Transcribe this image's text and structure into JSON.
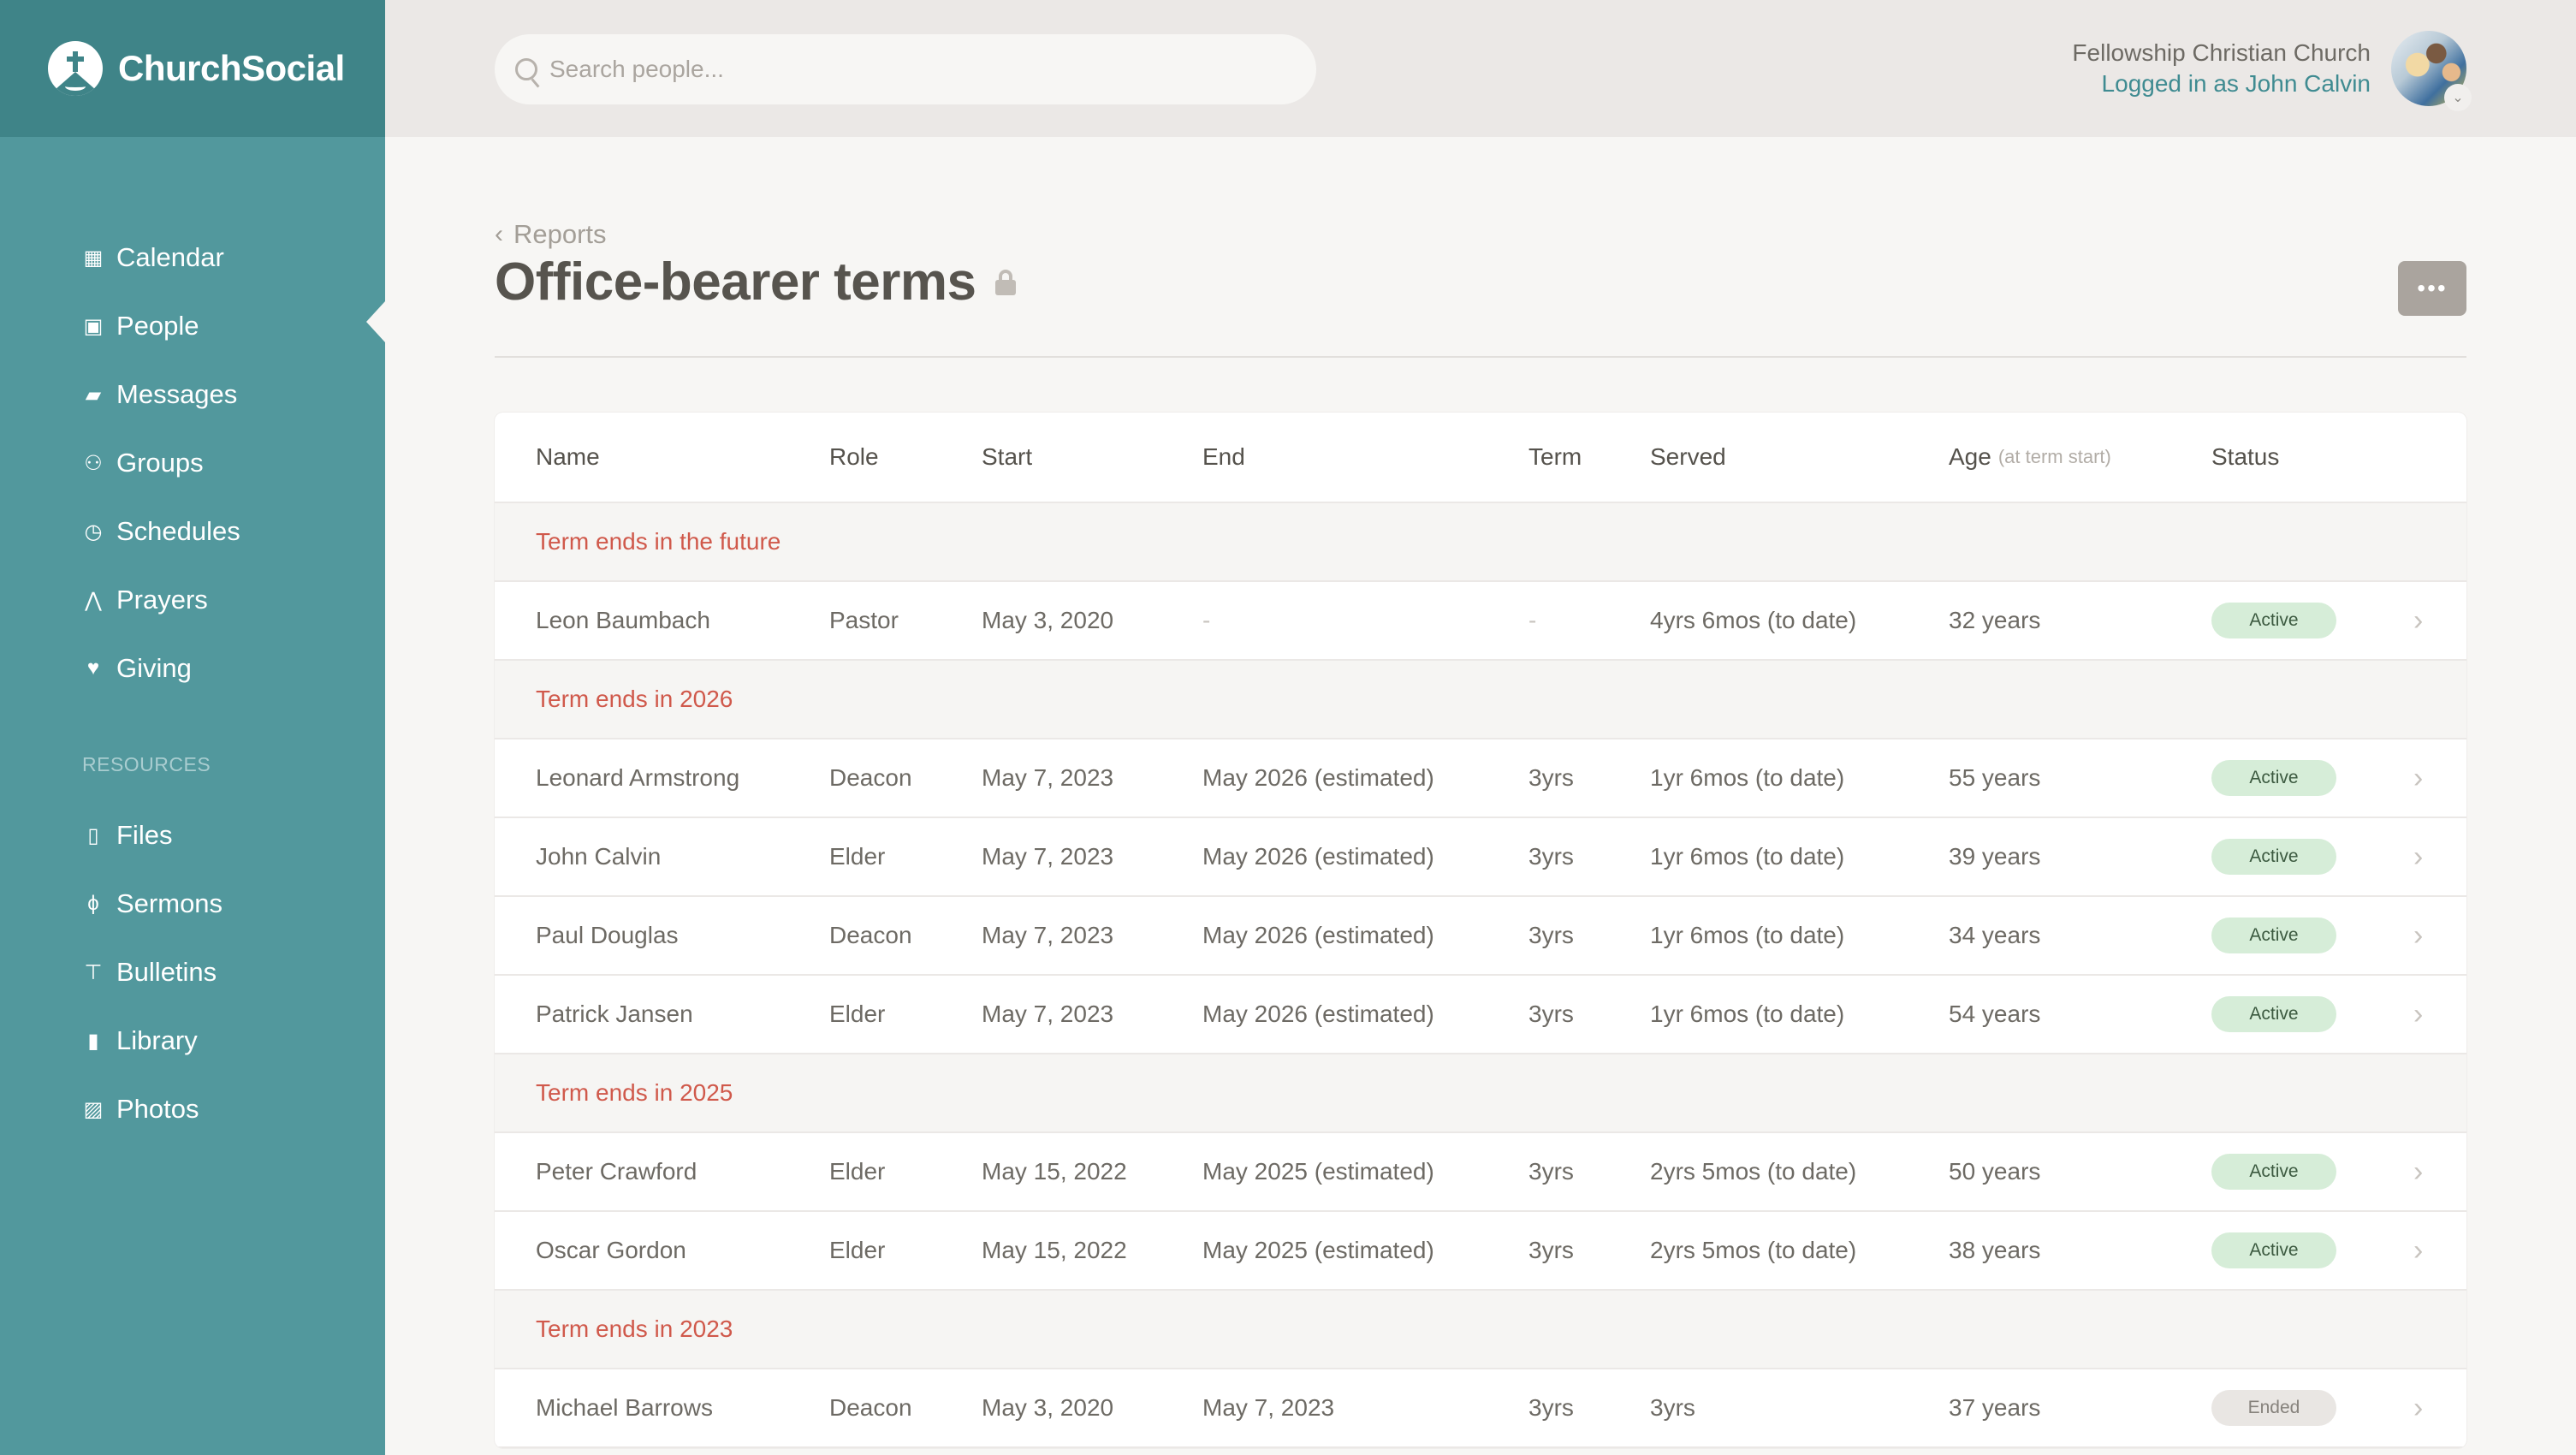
{
  "brand": {
    "name": "ChurchSocial",
    "logo_icon": "church-cross-icon"
  },
  "sidebar": {
    "items": [
      {
        "label": "Calendar",
        "icon": "calendar-icon",
        "glyph": "▦"
      },
      {
        "label": "People",
        "icon": "people-card-icon",
        "glyph": "▣",
        "active": true
      },
      {
        "label": "Messages",
        "icon": "chat-bubbles-icon",
        "glyph": "▰"
      },
      {
        "label": "Groups",
        "icon": "group-icon",
        "glyph": "⚇"
      },
      {
        "label": "Schedules",
        "icon": "clock-icon",
        "glyph": "◷"
      },
      {
        "label": "Prayers",
        "icon": "praying-hands-icon",
        "glyph": "⋀"
      },
      {
        "label": "Giving",
        "icon": "heart-icon",
        "glyph": "♥"
      }
    ],
    "section_label": "RESOURCES",
    "resources": [
      {
        "label": "Files",
        "icon": "file-icon",
        "glyph": "▯"
      },
      {
        "label": "Sermons",
        "icon": "microphone-icon",
        "glyph": "ϕ"
      },
      {
        "label": "Bulletins",
        "icon": "pushpin-icon",
        "glyph": "⊤"
      },
      {
        "label": "Library",
        "icon": "book-icon",
        "glyph": "▮"
      },
      {
        "label": "Photos",
        "icon": "image-icon",
        "glyph": "▨"
      }
    ]
  },
  "header": {
    "search_placeholder": "Search people...",
    "search_value": "",
    "church_name": "Fellowship Christian Church",
    "logged_in_text": "Logged in as John Calvin"
  },
  "page": {
    "breadcrumb": "Reports",
    "title": "Office-bearer terms",
    "more_label": "•••"
  },
  "table": {
    "columns": {
      "name": "Name",
      "role": "Role",
      "start": "Start",
      "end": "End",
      "term": "Term",
      "served": "Served",
      "age": "Age",
      "age_sub": "(at term start)",
      "status": "Status"
    },
    "groups": [
      {
        "label": "Term ends in the future",
        "rows": [
          {
            "name": "Leon Baumbach",
            "role": "Pastor",
            "start": "May 3, 2020",
            "end": "-",
            "term": "-",
            "served": "4yrs 6mos (to date)",
            "age": "32 years",
            "status": "Active"
          }
        ]
      },
      {
        "label": "Term ends in 2026",
        "rows": [
          {
            "name": "Leonard Armstrong",
            "role": "Deacon",
            "start": "May 7, 2023",
            "end": "May 2026 (estimated)",
            "term": "3yrs",
            "served": "1yr 6mos (to date)",
            "age": "55 years",
            "status": "Active"
          },
          {
            "name": "John Calvin",
            "role": "Elder",
            "start": "May 7, 2023",
            "end": "May 2026 (estimated)",
            "term": "3yrs",
            "served": "1yr 6mos (to date)",
            "age": "39 years",
            "status": "Active"
          },
          {
            "name": "Paul Douglas",
            "role": "Deacon",
            "start": "May 7, 2023",
            "end": "May 2026 (estimated)",
            "term": "3yrs",
            "served": "1yr 6mos (to date)",
            "age": "34 years",
            "status": "Active"
          },
          {
            "name": "Patrick Jansen",
            "role": "Elder",
            "start": "May 7, 2023",
            "end": "May 2026 (estimated)",
            "term": "3yrs",
            "served": "1yr 6mos (to date)",
            "age": "54 years",
            "status": "Active"
          }
        ]
      },
      {
        "label": "Term ends in 2025",
        "rows": [
          {
            "name": "Peter Crawford",
            "role": "Elder",
            "start": "May 15, 2022",
            "end": "May 2025 (estimated)",
            "term": "3yrs",
            "served": "2yrs 5mos (to date)",
            "age": "50 years",
            "status": "Active"
          },
          {
            "name": "Oscar Gordon",
            "role": "Elder",
            "start": "May 15, 2022",
            "end": "May 2025 (estimated)",
            "term": "3yrs",
            "served": "2yrs 5mos (to date)",
            "age": "38 years",
            "status": "Active"
          }
        ]
      },
      {
        "label": "Term ends in 2023",
        "rows": [
          {
            "name": "Michael Barrows",
            "role": "Deacon",
            "start": "May 3, 2020",
            "end": "May 7, 2023",
            "term": "3yrs",
            "served": "3yrs",
            "age": "37 years",
            "status": "Ended"
          }
        ]
      }
    ]
  },
  "colors": {
    "sidebar": "#52989d",
    "sidebar_header": "#3f8488",
    "accent_link": "#3f8b91",
    "group_label": "#d0594b",
    "active_badge": "#d6edd8",
    "ended_badge": "#e9e6e3"
  }
}
